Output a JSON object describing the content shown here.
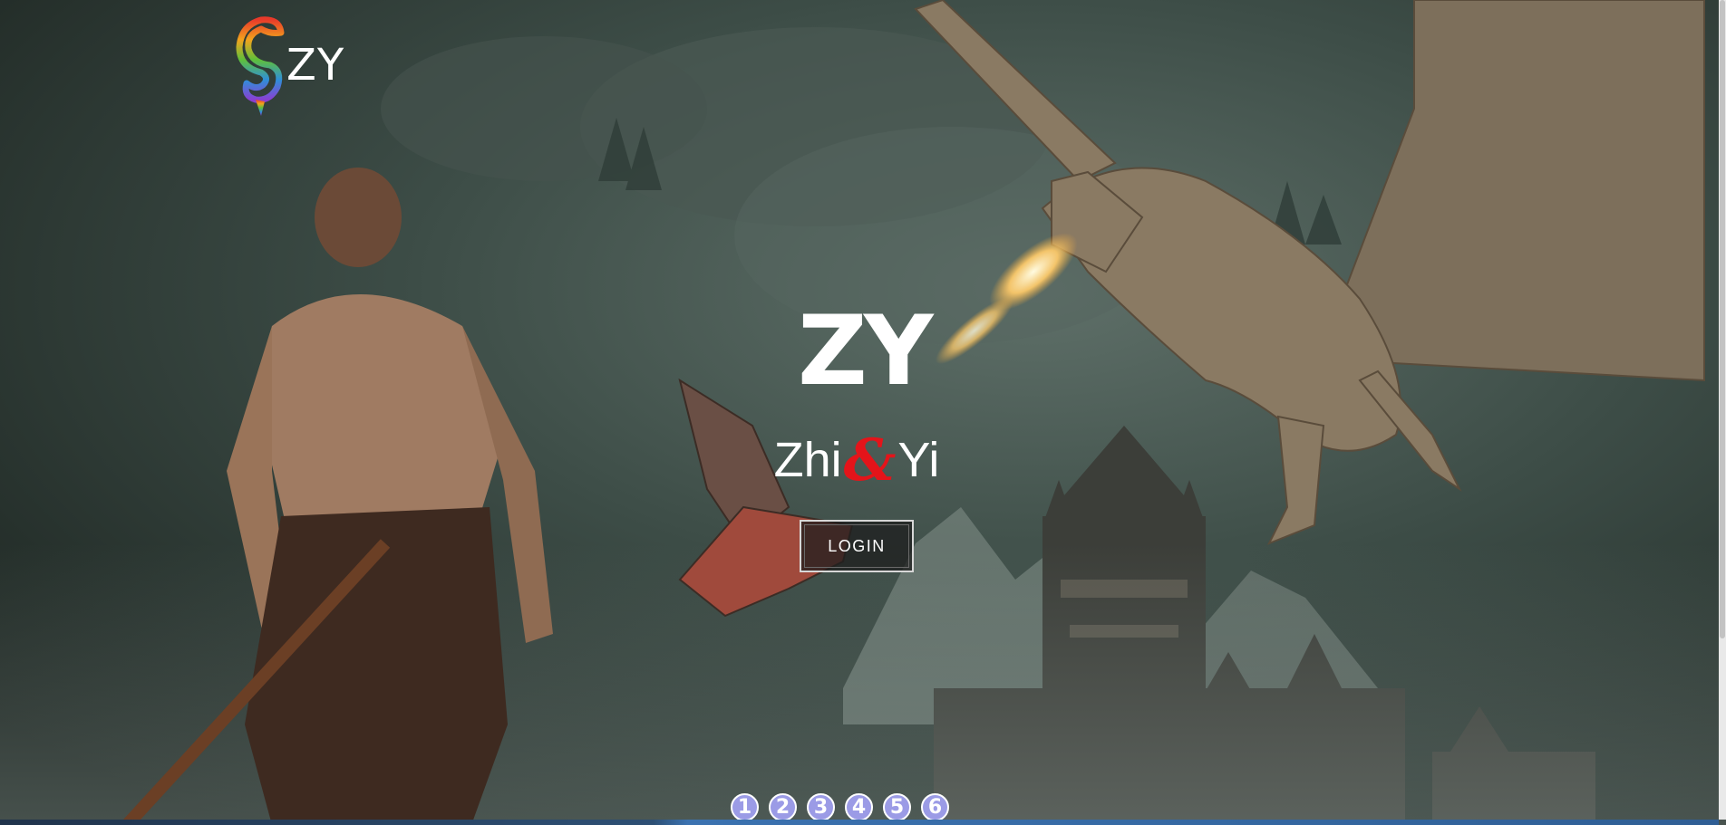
{
  "brand": {
    "text": "ZY",
    "icon": "rainbow-dragon-icon"
  },
  "hero": {
    "logo_text": "ZY",
    "name_left": "Zhi",
    "name_amp": "&",
    "name_right": "Yi",
    "login_label": "LOGIN"
  },
  "pager": {
    "pages": [
      "1",
      "2",
      "3",
      "4",
      "5",
      "6"
    ]
  },
  "colors": {
    "amp_red": "#e4141a",
    "pager_fill": "#9b9be6",
    "background": "#2c3a35"
  }
}
